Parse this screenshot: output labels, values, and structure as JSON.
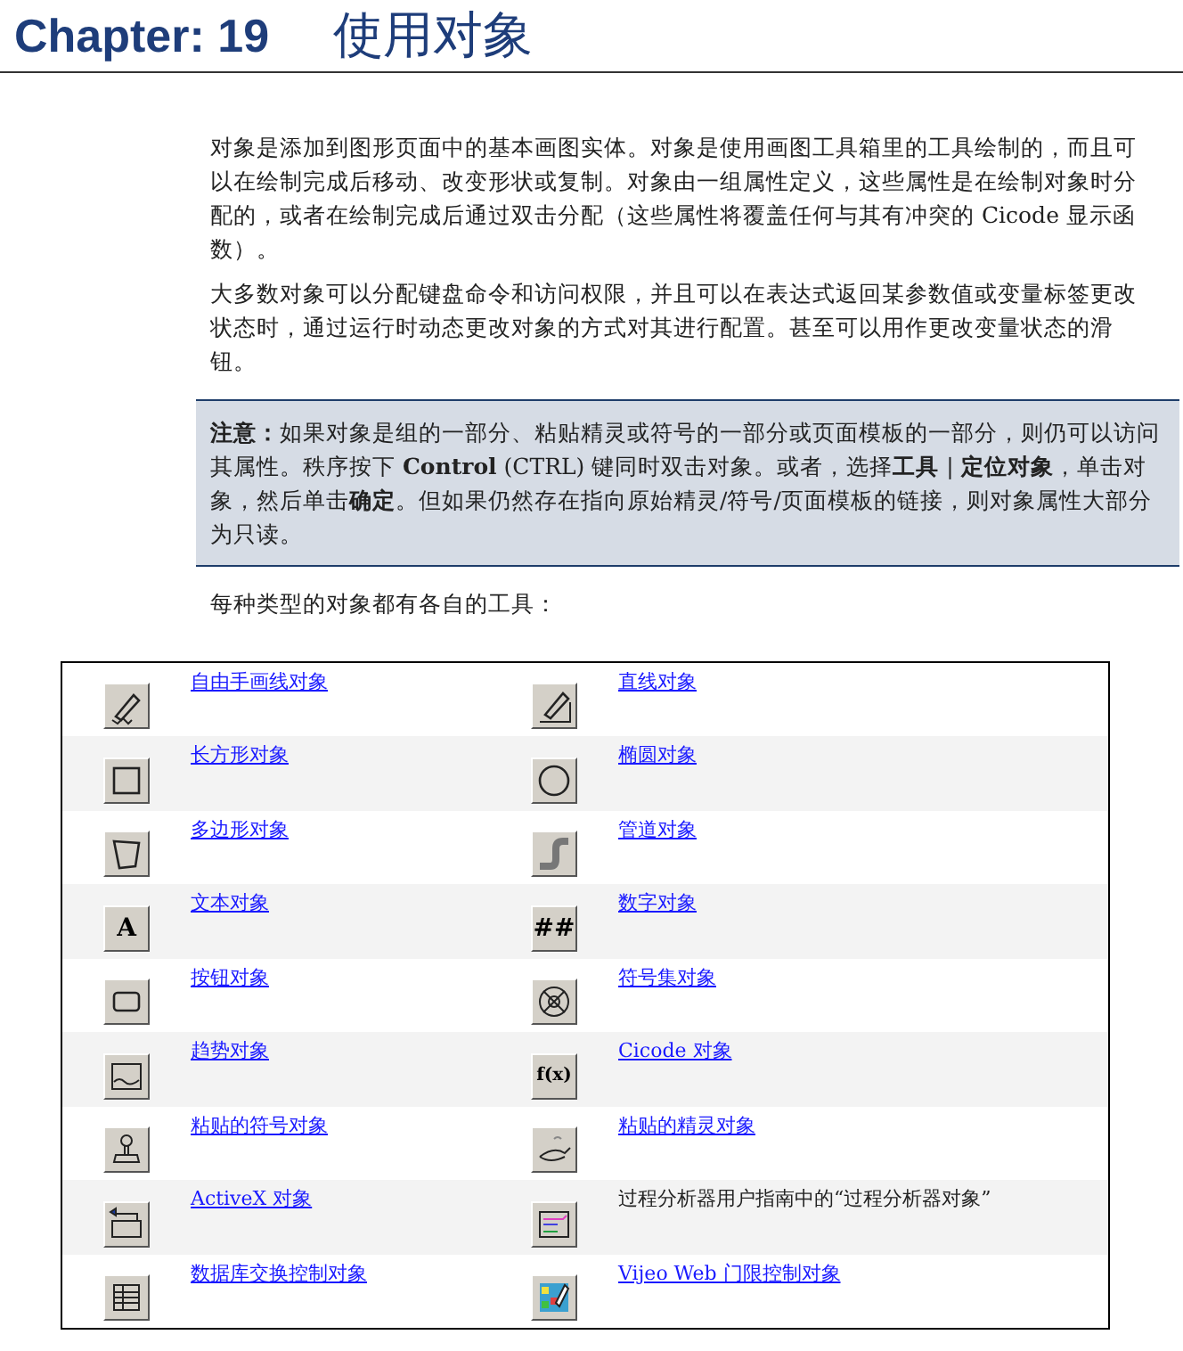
{
  "header": {
    "chapter": "Chapter: 19",
    "title": "使用对象"
  },
  "paragraphs": [
    "对象是添加到图形页面中的基本画图实体。对象是使用画图工具箱里的工具绘制的，而且可以在绘制完成后移动、改变形状或复制。对象由一组属性定义，这些属性是在绘制对象时分配的，或者在绘制完成后通过双击分配（这些属性将覆盖任何与其有冲突的 Cicode 显示函数）。",
    "大多数对象可以分配键盘命令和访问权限，并且可以在表达式返回某参数值或变量标签更改状态时，通过运行时动态更改对象的方式对其进行配置。甚至可以用作更改变量状态的滑钮。"
  ],
  "note": "**注意：**如果对象是组的一部分、粘贴精灵或符号的一部分或页面模板的一部分，则仍可以访问其属性。秩序按下 **Control** (CTRL) 键同时双击对象。或者，选择**工具** | **定位对象**，单击对象，然后单击**确定**。但如果仍然存在指向原始精灵/符号/页面模板的链接，则对象属性大部分为只读。",
  "intro": "每种类型的对象都有各自的工具：",
  "tools": [
    {
      "cells": [
        {
          "label": "自由手画线对象",
          "kind": "link"
        },
        {
          "label": "直线对象",
          "kind": "link"
        }
      ]
    },
    {
      "cells": [
        {
          "label": "长方形对象",
          "kind": "link"
        },
        {
          "label": "椭圆对象",
          "kind": "link"
        }
      ]
    },
    {
      "cells": [
        {
          "label": "多边形对象",
          "kind": "link"
        },
        {
          "label": "管道对象",
          "kind": "link"
        }
      ]
    },
    {
      "cells": [
        {
          "label": "文本对象",
          "kind": "link",
          "icon_text": "A"
        },
        {
          "label": "数字对象",
          "kind": "link",
          "icon_text": "##"
        }
      ]
    },
    {
      "cells": [
        {
          "label": "按钮对象",
          "kind": "link"
        },
        {
          "label": "符号集对象",
          "kind": "link"
        }
      ]
    },
    {
      "cells": [
        {
          "label": "趋势对象",
          "kind": "link"
        },
        {
          "label": "Cicode 对象",
          "kind": "link",
          "icon_text": "f(x)"
        }
      ]
    },
    {
      "cells": [
        {
          "label": "粘贴的符号对象",
          "kind": "link"
        },
        {
          "label": "粘贴的精灵对象",
          "kind": "link"
        }
      ]
    },
    {
      "cells": [
        {
          "label": "ActiveX 对象",
          "kind": "link"
        },
        {
          "label": "过程分析器用户指南中的“过程分析器对象”",
          "kind": "text"
        }
      ]
    },
    {
      "cells": [
        {
          "label": "数据库交换控制对象",
          "kind": "link"
        },
        {
          "label": "Vijeo Web 门限控制对象",
          "kind": "link"
        }
      ]
    }
  ]
}
